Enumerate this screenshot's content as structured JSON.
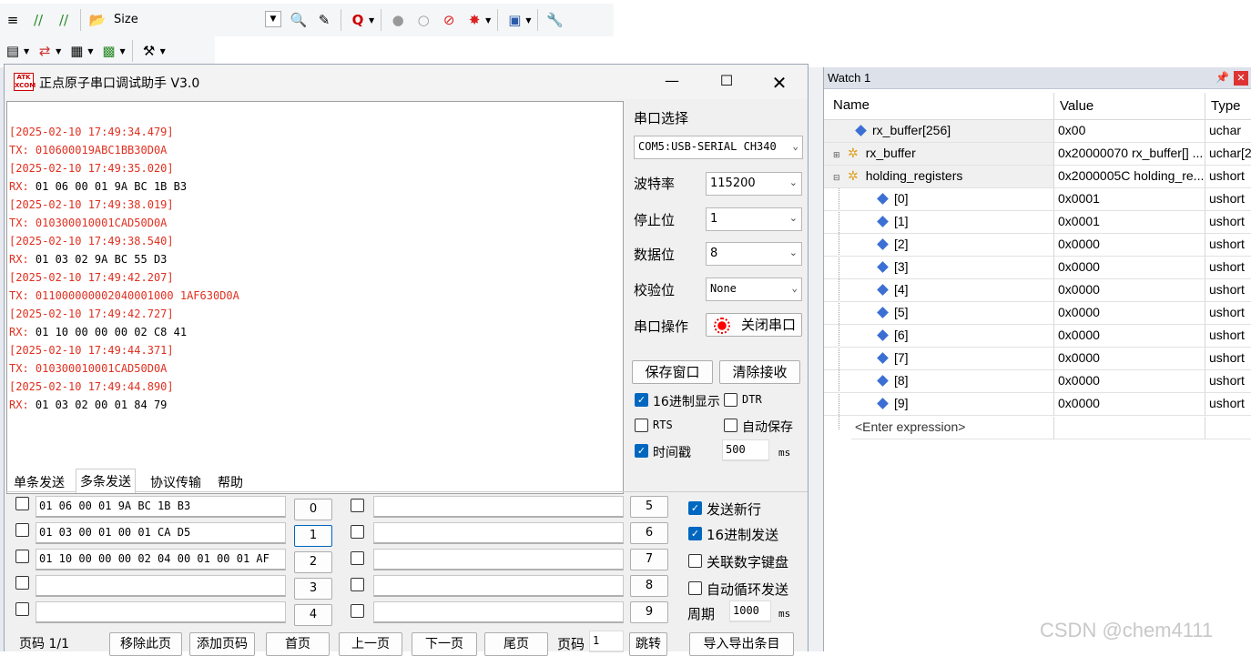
{
  "ide": {
    "size_label": "Size"
  },
  "serial": {
    "title": "正点原子串口调试助手 V3.0",
    "logo_text": "ATK XCOM",
    "receive_lines": [
      {
        "kind": "ts",
        "text": "[2025-02-10 17:49:34.479]"
      },
      {
        "kind": "tx",
        "text": "TX: 010600019ABC1BB30D0A"
      },
      {
        "kind": "ts",
        "text": "[2025-02-10 17:49:35.020]"
      },
      {
        "kind": "rx",
        "label": "RX:",
        "text": " 01 06 00 01 9A BC 1B B3"
      },
      {
        "kind": "ts",
        "text": "[2025-02-10 17:49:38.019]"
      },
      {
        "kind": "tx",
        "text": "TX: 010300010001CAD50D0A"
      },
      {
        "kind": "ts",
        "text": "[2025-02-10 17:49:38.540]"
      },
      {
        "kind": "rx",
        "label": "RX:",
        "text": " 01 03 02 9A BC 55 D3"
      },
      {
        "kind": "ts",
        "text": "[2025-02-10 17:49:42.207]"
      },
      {
        "kind": "tx",
        "text": "TX: 011000000002040001000 1AF630D0A"
      },
      {
        "kind": "ts",
        "text": "[2025-02-10 17:49:42.727]"
      },
      {
        "kind": "rx",
        "label": "RX:",
        "text": " 01 10 00 00 00 02 C8 41"
      },
      {
        "kind": "ts",
        "text": "[2025-02-10 17:49:44.371]"
      },
      {
        "kind": "tx",
        "text": "TX: 010300010001CAD50D0A"
      },
      {
        "kind": "ts",
        "text": "[2025-02-10 17:49:44.890]"
      },
      {
        "kind": "rx",
        "label": "RX:",
        "text": " 01 03 02 00 01 84 79"
      }
    ],
    "port_select_label": "串口选择",
    "port_value": "COM5:USB-SERIAL CH340",
    "baud_label": "波特率",
    "baud_value": "115200",
    "stop_label": "停止位",
    "stop_value": "1",
    "data_label": "数据位",
    "data_value": "8",
    "parity_label": "校验位",
    "parity_value": "None",
    "op_label": "串口操作",
    "close_port": "关闭串口",
    "save_window": "保存窗口",
    "clear_recv": "清除接收",
    "hex_display": "16进制显示",
    "dtr": "DTR",
    "rts": "RTS",
    "auto_save": "自动保存",
    "timestamp": "时间戳",
    "timestamp_ms": "500",
    "ms": "ms",
    "tabs": [
      "单条发送",
      "多条发送",
      "协议传输",
      "帮助"
    ],
    "multi_left": [
      {
        "text": "01 06 00 01 9A BC 1B B3",
        "num": "0"
      },
      {
        "text": "01 03 00 01 00 01 CA D5",
        "num": "1"
      },
      {
        "text": "01 10 00 00 00 02 04 00 01 00 01 AF",
        "num": "2"
      },
      {
        "text": "",
        "num": "3"
      },
      {
        "text": "",
        "num": "4"
      }
    ],
    "multi_right_nums": [
      "5",
      "6",
      "7",
      "8",
      "9"
    ],
    "send_newline": "发送新行",
    "hex_send": "16进制发送",
    "link_keypad": "关联数字键盘",
    "auto_cycle": "自动循环发送",
    "period_label": "周期",
    "period_value": "1000",
    "page_label": "页码 1/1",
    "remove_page": "移除此页",
    "add_page": "添加页码",
    "first": "首页",
    "prev": "上一页",
    "next": "下一页",
    "last": "尾页",
    "page_no_label": "页码",
    "page_no_value": "1",
    "jump": "跳转",
    "import_export": "导入导出条目"
  },
  "watch": {
    "title": "Watch 1",
    "col_name": "Name",
    "col_value": "Value",
    "col_type": "Type",
    "rows": [
      {
        "name": "rx_buffer[256]",
        "value": "0x00",
        "type": "uchar"
      },
      {
        "name": "rx_buffer",
        "value": "0x20000070 rx_buffer[] ...",
        "type": "uchar[2"
      },
      {
        "name": "holding_registers",
        "value": "0x2000005C holding_re...",
        "type": "ushort"
      },
      {
        "name": "[0]",
        "value": "0x0001",
        "type": "ushort"
      },
      {
        "name": "[1]",
        "value": "0x0001",
        "type": "ushort"
      },
      {
        "name": "[2]",
        "value": "0x0000",
        "type": "ushort"
      },
      {
        "name": "[3]",
        "value": "0x0000",
        "type": "ushort"
      },
      {
        "name": "[4]",
        "value": "0x0000",
        "type": "ushort"
      },
      {
        "name": "[5]",
        "value": "0x0000",
        "type": "ushort"
      },
      {
        "name": "[6]",
        "value": "0x0000",
        "type": "ushort"
      },
      {
        "name": "[7]",
        "value": "0x0000",
        "type": "ushort"
      },
      {
        "name": "[8]",
        "value": "0x0000",
        "type": "ushort"
      },
      {
        "name": "[9]",
        "value": "0x0000",
        "type": "ushort"
      }
    ],
    "enter_expression": "<Enter expression>"
  },
  "watermark": "CSDN @chem4111"
}
